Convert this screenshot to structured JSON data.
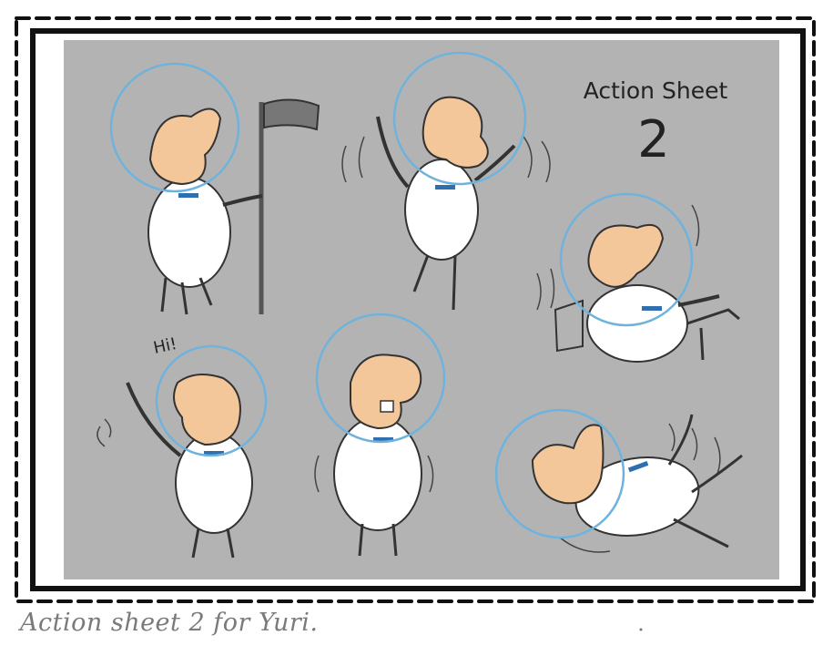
{
  "sheet": {
    "title_line1": "Action Sheet",
    "title_line2": "2",
    "background_color": "#b3b3b3",
    "frame_color": "#111111"
  },
  "character": {
    "skin_color": "#f4c79a",
    "suit_color": "#ffffff",
    "visor_color": "#6fb3dd",
    "badge_color": "#2f6fb0"
  },
  "poses": [
    {
      "name": "standing-with-flag"
    },
    {
      "name": "jumping-struggle"
    },
    {
      "name": "riding-vehicle"
    },
    {
      "name": "waving-hi",
      "speech": "Hi!"
    },
    {
      "name": "shivering-teeth"
    },
    {
      "name": "floating-tumble"
    }
  ],
  "caption": "Action sheet 2 for Yuri."
}
